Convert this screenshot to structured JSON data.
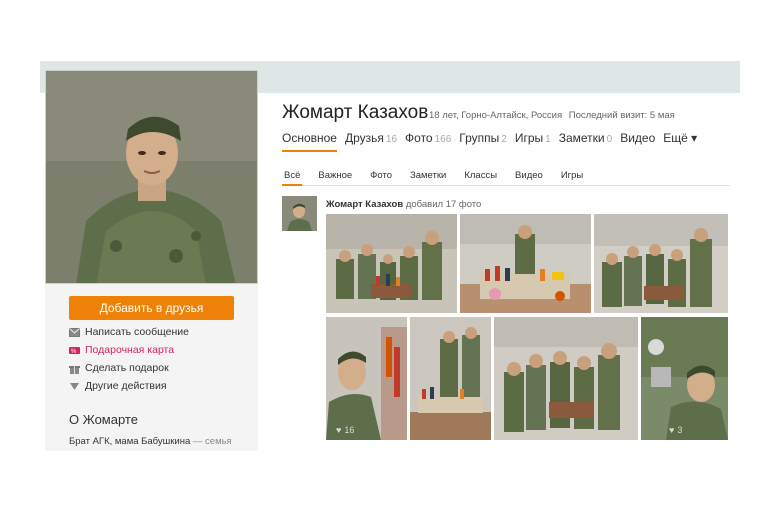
{
  "profile": {
    "name": "Жомарт Казахов",
    "age_location": "18 лет, Горно-Алтайск, Россия",
    "last_visit": "Последний визит: 5 мая"
  },
  "nav": [
    {
      "label": "Основное",
      "count": ""
    },
    {
      "label": "Друзья",
      "count": "16"
    },
    {
      "label": "Фото",
      "count": "166"
    },
    {
      "label": "Группы",
      "count": "2"
    },
    {
      "label": "Игры",
      "count": "1"
    },
    {
      "label": "Заметки",
      "count": "0"
    },
    {
      "label": "Видео",
      "count": ""
    },
    {
      "label": "Ещё ▾",
      "count": ""
    }
  ],
  "subtabs": [
    "Всё",
    "Важное",
    "Фото",
    "Заметки",
    "Классы",
    "Видео",
    "Игры"
  ],
  "sidebar": {
    "add_friend": "Добавить в друзья",
    "actions": [
      {
        "label": "Написать сообщение",
        "icon": "envelope-icon"
      },
      {
        "label": "Подарочная карта",
        "icon": "gift-card-icon"
      },
      {
        "label": "Сделать подарок",
        "icon": "gift-icon"
      },
      {
        "label": "Другие действия",
        "icon": "triangle-down-icon"
      }
    ],
    "about_title": "О Жомарте",
    "about_text": "Брат АГК, мама Бабушкина",
    "about_suffix": "— семья"
  },
  "feed": {
    "author": "Жомарт Казахов",
    "action": "добавил 17 фото",
    "photos_like_counts": [
      "16",
      "3"
    ]
  },
  "colors": {
    "accent": "#ee8208",
    "gift_card": "#d4245b",
    "topbar": "#dfe6e6"
  }
}
